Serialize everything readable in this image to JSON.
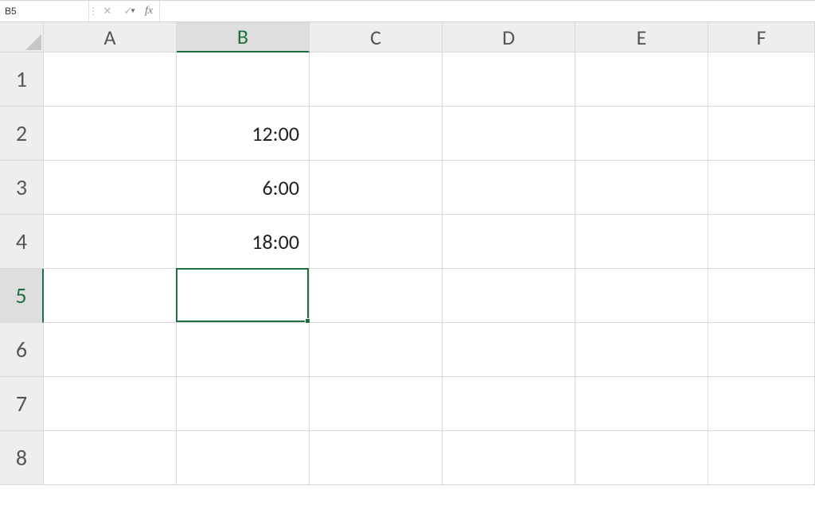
{
  "formula_bar": {
    "name_box_value": "B5",
    "cancel_symbol": "✕",
    "enter_symbol": "✓",
    "fx_symbol": "fx",
    "formula_value": ""
  },
  "columns": [
    "A",
    "B",
    "C",
    "D",
    "E",
    "F"
  ],
  "rows": [
    "1",
    "2",
    "3",
    "4",
    "5",
    "6",
    "7",
    "8"
  ],
  "selected_column": "B",
  "selected_row": "5",
  "cells": {
    "B2": "12:00",
    "B3": "6:00",
    "B4": "18:00"
  },
  "chart_data": {
    "type": "table",
    "columns": [
      "A",
      "B",
      "C",
      "D",
      "E",
      "F"
    ],
    "rows": {
      "1": {},
      "2": {
        "B": "12:00"
      },
      "3": {
        "B": "6:00"
      },
      "4": {
        "B": "18:00"
      },
      "5": {},
      "6": {},
      "7": {},
      "8": {}
    },
    "active_cell": "B5"
  }
}
